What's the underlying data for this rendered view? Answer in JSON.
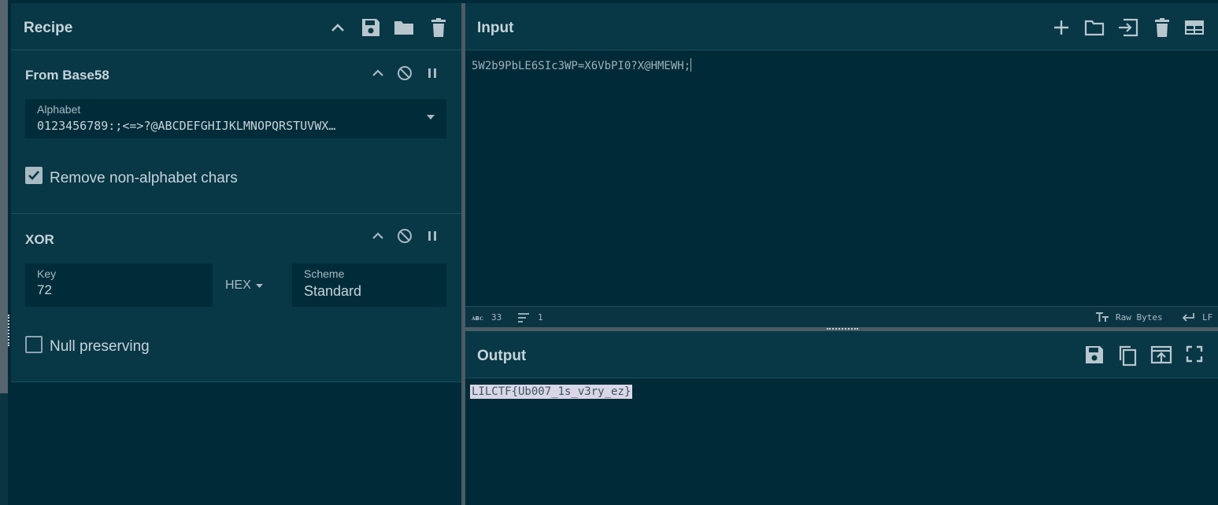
{
  "recipe": {
    "title": "Recipe",
    "header_icons": [
      "chevron-up-icon",
      "save-icon",
      "folder-icon",
      "trash-icon"
    ],
    "operations": [
      {
        "name": "From Base58",
        "alphabet_label": "Alphabet",
        "alphabet_value": "0123456789:;<=>?@ABCDEFGHIJKLMNOPQRSTUVWX…",
        "checkbox_label": "Remove non-alphabet chars",
        "checkbox_checked": true
      },
      {
        "name": "XOR",
        "key_label": "Key",
        "key_value": "72",
        "key_format": "HEX",
        "scheme_label": "Scheme",
        "scheme_value": "Standard",
        "checkbox_label": "Null preserving",
        "checkbox_checked": false
      }
    ]
  },
  "input": {
    "title": "Input",
    "text": "5W2b9PbLE6SIc3WP=X6VbPI0?X@HMEWH;",
    "status": {
      "abc_label": "ᴀʙᴄ",
      "length": "33",
      "lines": "1",
      "format": "Raw Bytes",
      "eol": "LF"
    }
  },
  "output": {
    "title": "Output",
    "text": "LILCTF{Ub007_1s_v3ry_ez}"
  },
  "colors": {
    "background": "#012a38",
    "panel_header": "#083746",
    "selection": "#d9d6e8"
  }
}
